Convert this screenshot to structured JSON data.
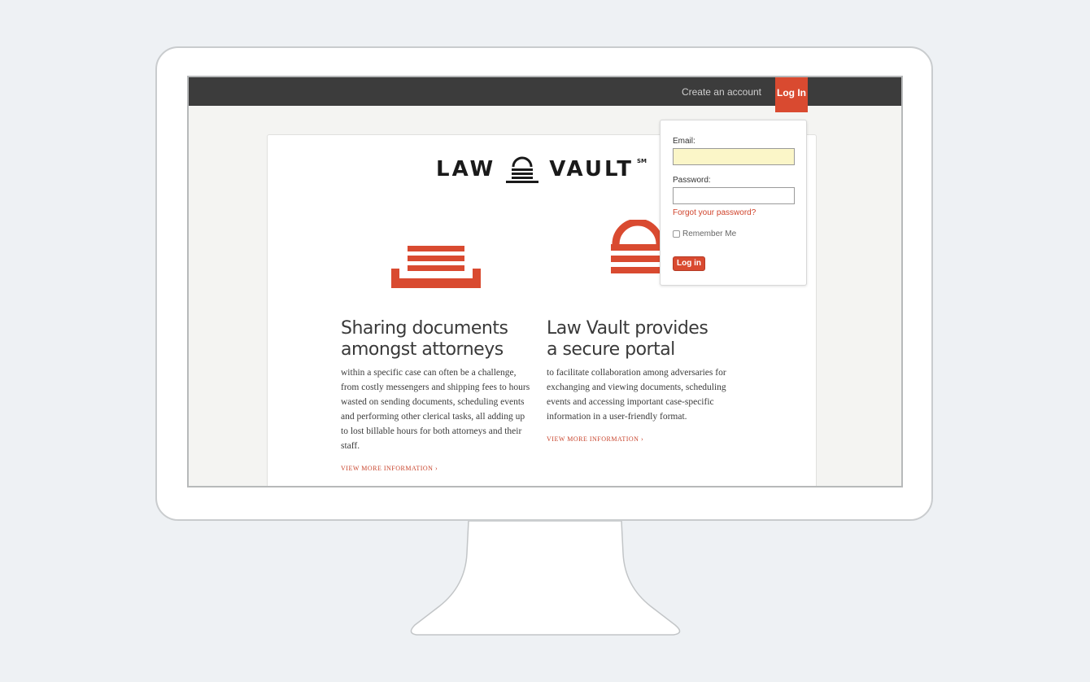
{
  "nav": {
    "create_account": "Create an account",
    "login_tab": "Log In"
  },
  "logo": {
    "left_word": "LAW",
    "right_word": "VAULT",
    "mark": "SM"
  },
  "features": [
    {
      "icon": "document-tray-icon",
      "heading_line1": "Sharing documents",
      "heading_line2": "amongst attorneys",
      "body": "within a specific case can often be a challenge, from costly messengers and shipping fees to hours wasted on sending documents, scheduling events and performing other clerical tasks, all adding up to lost billable hours for both attorneys and their staff.",
      "more": "VIEW MORE INFORMATION ›"
    },
    {
      "icon": "padlock-icon",
      "heading_line1": "Law Vault provides",
      "heading_line2": "a secure portal",
      "body": "to facilitate collaboration among adversaries for exchanging and viewing documents, scheduling events and accessing important case-specific information in a user-friendly format.",
      "more": "VIEW MORE INFORMATION ›"
    }
  ],
  "login": {
    "email_label": "Email:",
    "email_value": "",
    "password_label": "Password:",
    "password_value": "",
    "forgot": "Forgot your password?",
    "remember": "Remember Me",
    "submit": "Log in"
  },
  "colors": {
    "accent": "#d94a30",
    "nav_bg": "#3c3c3c",
    "email_field_bg": "#fbf6c8"
  }
}
